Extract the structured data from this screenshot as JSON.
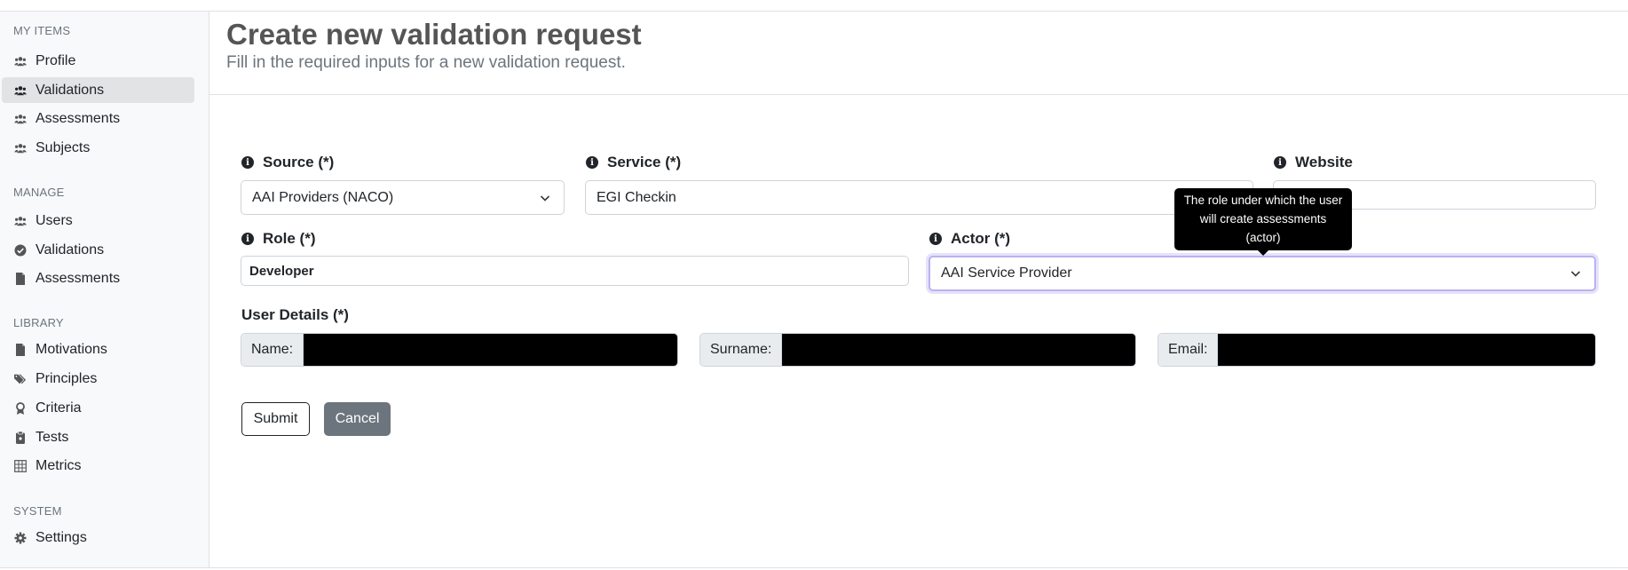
{
  "sidebar": {
    "sections": [
      {
        "heading": "MY ITEMS",
        "items": [
          {
            "label": "Profile",
            "icon": "users-icon"
          },
          {
            "label": "Validations",
            "icon": "users-icon",
            "active": true
          },
          {
            "label": "Assessments",
            "icon": "users-icon"
          },
          {
            "label": "Subjects",
            "icon": "users-icon"
          }
        ]
      },
      {
        "heading": "MANAGE",
        "items": [
          {
            "label": "Users",
            "icon": "users-icon"
          },
          {
            "label": "Validations",
            "icon": "check-circle-icon"
          },
          {
            "label": "Assessments",
            "icon": "file-icon"
          }
        ]
      },
      {
        "heading": "LIBRARY",
        "items": [
          {
            "label": "Motivations",
            "icon": "file-icon"
          },
          {
            "label": "Principles",
            "icon": "tags-icon"
          },
          {
            "label": "Criteria",
            "icon": "award-icon"
          },
          {
            "label": "Tests",
            "icon": "clipboard-icon"
          },
          {
            "label": "Metrics",
            "icon": "table-icon"
          }
        ]
      },
      {
        "heading": "SYSTEM",
        "items": [
          {
            "label": "Settings",
            "icon": "gear-icon"
          }
        ]
      }
    ]
  },
  "header": {
    "title": "Create new validation request",
    "subtitle": "Fill in the required inputs for a new validation request."
  },
  "form": {
    "source": {
      "label": "Source (*)",
      "value": "AAI Providers (NACO)"
    },
    "service": {
      "label": "Service (*)",
      "value": "EGI Checkin"
    },
    "website": {
      "label": "Website",
      "value": ""
    },
    "role": {
      "label": "Role (*)",
      "value": "Developer"
    },
    "actor": {
      "label": "Actor (*)",
      "value": "AAI Service Provider"
    },
    "user_details": {
      "label": "User Details (*)",
      "name_prefix": "Name:",
      "surname_prefix": "Surname:",
      "email_prefix": "Email:"
    },
    "submit_label": "Submit",
    "cancel_label": "Cancel"
  },
  "tooltip": {
    "text": "The role under which the user will create assessments (actor)"
  }
}
